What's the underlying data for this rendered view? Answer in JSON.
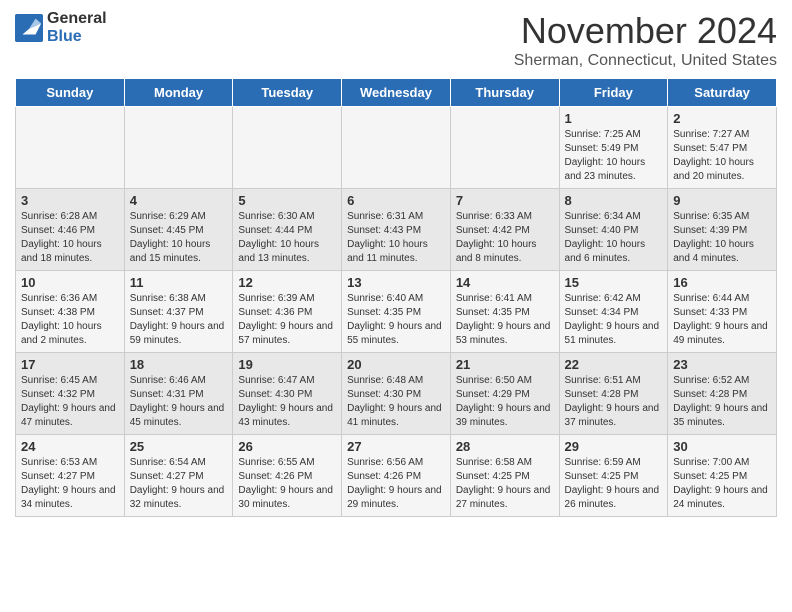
{
  "header": {
    "logo": {
      "general": "General",
      "blue": "Blue"
    },
    "title": "November 2024",
    "subtitle": "Sherman, Connecticut, United States"
  },
  "weekdays": [
    "Sunday",
    "Monday",
    "Tuesday",
    "Wednesday",
    "Thursday",
    "Friday",
    "Saturday"
  ],
  "weeks": [
    [
      null,
      null,
      null,
      null,
      null,
      {
        "day": "1",
        "sunrise": "7:25 AM",
        "sunset": "5:49 PM",
        "daylight": "10 hours and 23 minutes."
      },
      {
        "day": "2",
        "sunrise": "7:27 AM",
        "sunset": "5:47 PM",
        "daylight": "10 hours and 20 minutes."
      }
    ],
    [
      {
        "day": "3",
        "sunrise": "6:28 AM",
        "sunset": "4:46 PM",
        "daylight": "10 hours and 18 minutes."
      },
      {
        "day": "4",
        "sunrise": "6:29 AM",
        "sunset": "4:45 PM",
        "daylight": "10 hours and 15 minutes."
      },
      {
        "day": "5",
        "sunrise": "6:30 AM",
        "sunset": "4:44 PM",
        "daylight": "10 hours and 13 minutes."
      },
      {
        "day": "6",
        "sunrise": "6:31 AM",
        "sunset": "4:43 PM",
        "daylight": "10 hours and 11 minutes."
      },
      {
        "day": "7",
        "sunrise": "6:33 AM",
        "sunset": "4:42 PM",
        "daylight": "10 hours and 8 minutes."
      },
      {
        "day": "8",
        "sunrise": "6:34 AM",
        "sunset": "4:40 PM",
        "daylight": "10 hours and 6 minutes."
      },
      {
        "day": "9",
        "sunrise": "6:35 AM",
        "sunset": "4:39 PM",
        "daylight": "10 hours and 4 minutes."
      }
    ],
    [
      {
        "day": "10",
        "sunrise": "6:36 AM",
        "sunset": "4:38 PM",
        "daylight": "10 hours and 2 minutes."
      },
      {
        "day": "11",
        "sunrise": "6:38 AM",
        "sunset": "4:37 PM",
        "daylight": "9 hours and 59 minutes."
      },
      {
        "day": "12",
        "sunrise": "6:39 AM",
        "sunset": "4:36 PM",
        "daylight": "9 hours and 57 minutes."
      },
      {
        "day": "13",
        "sunrise": "6:40 AM",
        "sunset": "4:35 PM",
        "daylight": "9 hours and 55 minutes."
      },
      {
        "day": "14",
        "sunrise": "6:41 AM",
        "sunset": "4:35 PM",
        "daylight": "9 hours and 53 minutes."
      },
      {
        "day": "15",
        "sunrise": "6:42 AM",
        "sunset": "4:34 PM",
        "daylight": "9 hours and 51 minutes."
      },
      {
        "day": "16",
        "sunrise": "6:44 AM",
        "sunset": "4:33 PM",
        "daylight": "9 hours and 49 minutes."
      }
    ],
    [
      {
        "day": "17",
        "sunrise": "6:45 AM",
        "sunset": "4:32 PM",
        "daylight": "9 hours and 47 minutes."
      },
      {
        "day": "18",
        "sunrise": "6:46 AM",
        "sunset": "4:31 PM",
        "daylight": "9 hours and 45 minutes."
      },
      {
        "day": "19",
        "sunrise": "6:47 AM",
        "sunset": "4:30 PM",
        "daylight": "9 hours and 43 minutes."
      },
      {
        "day": "20",
        "sunrise": "6:48 AM",
        "sunset": "4:30 PM",
        "daylight": "9 hours and 41 minutes."
      },
      {
        "day": "21",
        "sunrise": "6:50 AM",
        "sunset": "4:29 PM",
        "daylight": "9 hours and 39 minutes."
      },
      {
        "day": "22",
        "sunrise": "6:51 AM",
        "sunset": "4:28 PM",
        "daylight": "9 hours and 37 minutes."
      },
      {
        "day": "23",
        "sunrise": "6:52 AM",
        "sunset": "4:28 PM",
        "daylight": "9 hours and 35 minutes."
      }
    ],
    [
      {
        "day": "24",
        "sunrise": "6:53 AM",
        "sunset": "4:27 PM",
        "daylight": "9 hours and 34 minutes."
      },
      {
        "day": "25",
        "sunrise": "6:54 AM",
        "sunset": "4:27 PM",
        "daylight": "9 hours and 32 minutes."
      },
      {
        "day": "26",
        "sunrise": "6:55 AM",
        "sunset": "4:26 PM",
        "daylight": "9 hours and 30 minutes."
      },
      {
        "day": "27",
        "sunrise": "6:56 AM",
        "sunset": "4:26 PM",
        "daylight": "9 hours and 29 minutes."
      },
      {
        "day": "28",
        "sunrise": "6:58 AM",
        "sunset": "4:25 PM",
        "daylight": "9 hours and 27 minutes."
      },
      {
        "day": "29",
        "sunrise": "6:59 AM",
        "sunset": "4:25 PM",
        "daylight": "9 hours and 26 minutes."
      },
      {
        "day": "30",
        "sunrise": "7:00 AM",
        "sunset": "4:25 PM",
        "daylight": "9 hours and 24 minutes."
      }
    ]
  ]
}
